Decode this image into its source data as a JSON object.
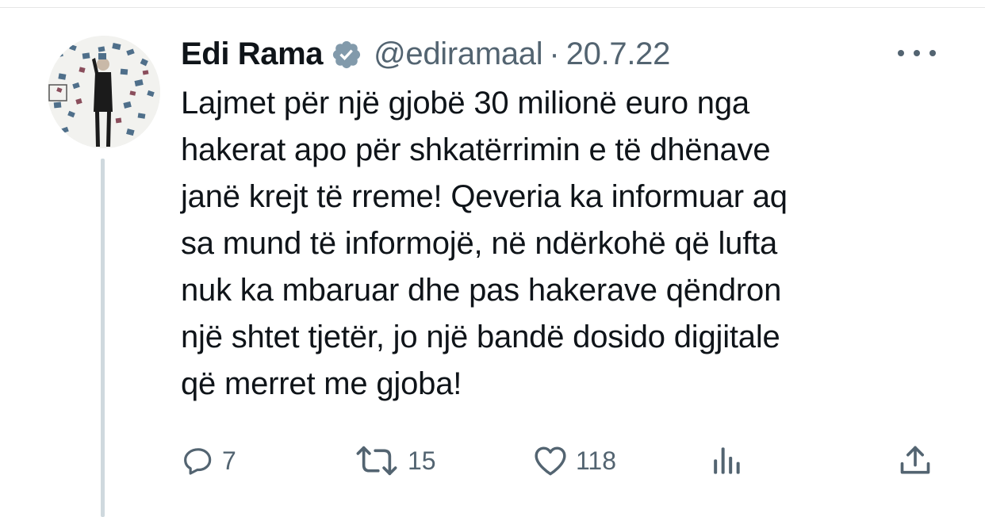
{
  "tweet": {
    "author_name": "Edi Rama",
    "verified": true,
    "handle": "@ediramaal",
    "separator": "·",
    "date": "20.7.22",
    "text_lines": [
      "Lajmet për një gjobë 30 milionë euro nga",
      "hakerat apo për shkatërrimin e të dhënave",
      "janë krejt të rreme! Qeveria ka informuar aq",
      "sa mund të informojë, në ndërkohë që lufta",
      "nuk ka mbaruar dhe pas hakerave qëndron",
      "një shtet tjetër, jo një bandë dosido digjitale",
      "që merret me gjoba!"
    ],
    "actions": {
      "replies": "7",
      "retweets": "15",
      "likes": "118"
    }
  },
  "icons": {
    "verified": "verified-badge-icon",
    "more": "more-horizontal-icon",
    "reply": "reply-icon",
    "retweet": "retweet-icon",
    "like": "heart-icon",
    "views": "analytics-icon",
    "share": "share-icon"
  },
  "colors": {
    "text": "#0f1419",
    "secondary": "#536471",
    "thread_line": "#cfd9de"
  }
}
